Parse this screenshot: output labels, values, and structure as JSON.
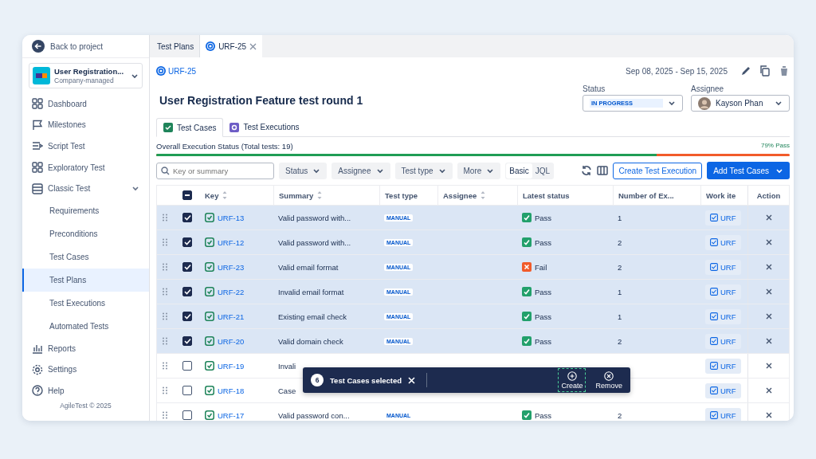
{
  "sidebar": {
    "back_link": "Back to project",
    "project": {
      "name": "User Registration...",
      "type": "Company-managed"
    },
    "items": [
      {
        "label": "Dashboard",
        "selected": false
      },
      {
        "label": "Milestones",
        "selected": false
      },
      {
        "label": "Script Test",
        "selected": false
      },
      {
        "label": "Exploratory Test",
        "selected": false
      },
      {
        "label": "Classic Test",
        "selected": false,
        "expanded": true,
        "children": [
          {
            "label": "Requirements",
            "selected": false
          },
          {
            "label": "Preconditions",
            "selected": false
          },
          {
            "label": "Test Cases",
            "selected": false
          },
          {
            "label": "Test Plans",
            "selected": true
          },
          {
            "label": "Test Executions",
            "selected": false
          },
          {
            "label": "Automated Tests",
            "selected": false
          }
        ]
      },
      {
        "label": "Reports",
        "selected": false
      },
      {
        "label": "Settings",
        "selected": false
      },
      {
        "label": "Help",
        "selected": false
      }
    ],
    "footer": "AgileTest © 2025"
  },
  "tabs": [
    {
      "label": "Test Plans",
      "selected": false,
      "closable": false
    },
    {
      "label": "URF-25",
      "selected": true,
      "closable": true
    }
  ],
  "header": {
    "key": "URF-25",
    "title": "User Registration Feature test round 1",
    "date_range": "Sep 08, 2025 - Sep 15, 2025",
    "status": {
      "label": "Status",
      "value": "IN PROGRESS"
    },
    "assignee": {
      "label": "Assignee",
      "name": "Kayson Phan"
    }
  },
  "content_tabs": [
    {
      "label": "Test Cases",
      "selected": true
    },
    {
      "label": "Test Executions",
      "selected": false
    }
  ],
  "progress": {
    "label": "Overall Execution Status (Total tests: 19)",
    "reading": "79% Pass",
    "level": 0.79
  },
  "toolbar": {
    "search_placeholder": "Key or summary",
    "filters": [
      "Status",
      "Assignee",
      "Test type",
      "More"
    ],
    "modes": [
      {
        "label": "Basic",
        "selected": true
      },
      {
        "label": "JQL",
        "selected": false
      }
    ],
    "secondary_button": "Create Test Execution",
    "primary_button": "Add Test Cases"
  },
  "table": {
    "select_all": {
      "checked": true,
      "indeterminate": true
    },
    "columns": [
      {
        "label": "Key",
        "sortable": true
      },
      {
        "label": "Summary",
        "sortable": true
      },
      {
        "label": "Test type",
        "sortable": false
      },
      {
        "label": "Assignee",
        "sortable": true
      },
      {
        "label": "Latest status",
        "sortable": false
      },
      {
        "label": "Number of Ex...",
        "sortable": false
      },
      {
        "label": "Work ite",
        "sortable": false
      },
      {
        "label": "Action",
        "sortable": false
      }
    ],
    "rows": [
      {
        "key": "URF-13",
        "summary": "Valid password with...",
        "test_type": "MANUAL",
        "status": {
          "kind": "pass",
          "label": "Pass"
        },
        "executions": "1",
        "work_item": "URF",
        "selected": true
      },
      {
        "key": "URF-12",
        "summary": "Valid password with...",
        "test_type": "MANUAL",
        "status": {
          "kind": "pass",
          "label": "Pass"
        },
        "executions": "2",
        "work_item": "URF",
        "selected": true
      },
      {
        "key": "URF-23",
        "summary": "Valid email format",
        "test_type": "MANUAL",
        "status": {
          "kind": "fail",
          "label": "Fail"
        },
        "executions": "2",
        "work_item": "URF",
        "selected": true
      },
      {
        "key": "URF-22",
        "summary": "Invalid email format",
        "test_type": "MANUAL",
        "status": {
          "kind": "pass",
          "label": "Pass"
        },
        "executions": "1",
        "work_item": "URF",
        "selected": true
      },
      {
        "key": "URF-21",
        "summary": "Existing email check",
        "test_type": "MANUAL",
        "status": {
          "kind": "pass",
          "label": "Pass"
        },
        "executions": "1",
        "work_item": "URF",
        "selected": true
      },
      {
        "key": "URF-20",
        "summary": "Valid domain check",
        "test_type": "MANUAL",
        "status": {
          "kind": "pass",
          "label": "Pass"
        },
        "executions": "2",
        "work_item": "URF",
        "selected": true
      },
      {
        "key": "URF-19",
        "summary": "Invali",
        "work_item": "URF",
        "selected": false
      },
      {
        "key": "URF-18",
        "summary": "Case",
        "work_item": "URF",
        "selected": false
      },
      {
        "key": "URF-17",
        "summary": "Valid password con...",
        "test_type": "MANUAL",
        "status": {
          "kind": "pass",
          "label": "Pass"
        },
        "executions": "2",
        "work_item": "URF",
        "selected": false
      }
    ]
  },
  "selection_bar": {
    "count": "6",
    "label": "Test Cases selected",
    "actions": [
      {
        "label": "Create",
        "kind": "create",
        "focused": true
      },
      {
        "label": "Remove",
        "kind": "remove",
        "focused": false
      }
    ]
  }
}
